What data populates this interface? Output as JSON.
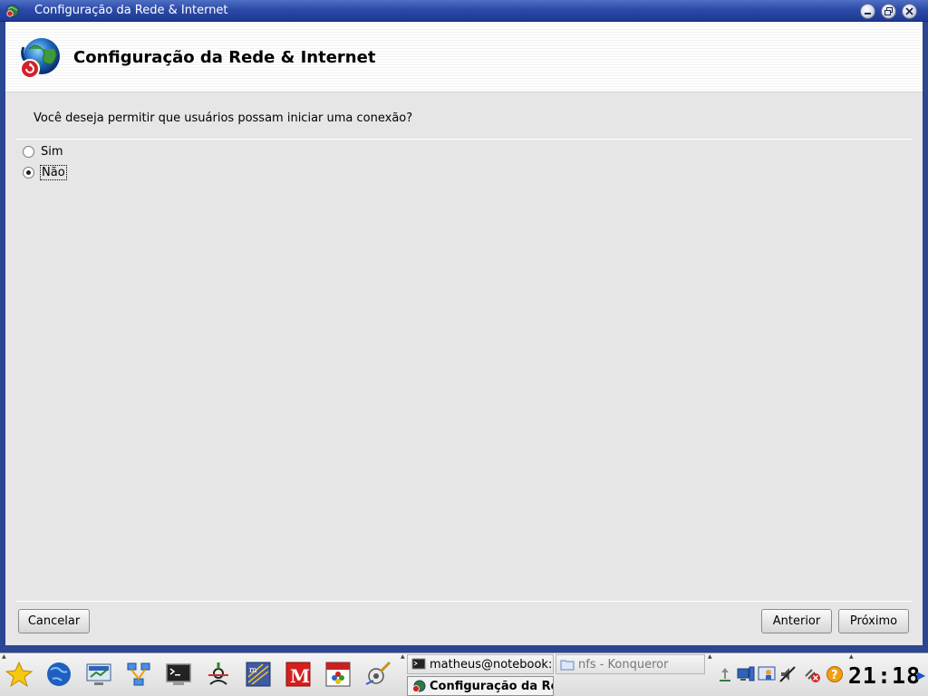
{
  "window": {
    "title": "Configuração da Rede & Internet"
  },
  "header": {
    "heading": "Configuração da Rede & Internet"
  },
  "main": {
    "question": "Você deseja permitir que usuários possam iniciar uma conexão?",
    "options": [
      {
        "label": "Sim",
        "selected": false
      },
      {
        "label": "Não",
        "selected": true
      }
    ]
  },
  "buttons": {
    "cancel": "Cancelar",
    "previous": "Anterior",
    "next": "Próximo"
  },
  "taskbar": {
    "launchers": [
      "kde-star-icon",
      "globe-icon",
      "network-monitor-icon",
      "network-share-icon",
      "terminal-icon",
      "package-tool-icon",
      "music-editor-icon",
      "mail-m-icon",
      "snes-emulator-icon",
      "system-config-icon"
    ],
    "tasks": [
      {
        "label": "matheus@notebook:",
        "icon": "terminal-icon",
        "active": false
      },
      {
        "label": "nfs - Konqueror",
        "icon": "folder-icon",
        "active": false
      },
      {
        "label": "Configuração da Re",
        "icon": "network-config-icon",
        "active": true
      }
    ],
    "tray": [
      "network-up-icon",
      "display-icon",
      "screen-config-icon",
      "volume-muted-icon",
      "network-disconnected-icon",
      "help-icon"
    ],
    "clock": "21:18"
  },
  "colors": {
    "titlebar": "#2c4aa8",
    "window_bg": "#e6e6e6",
    "frame": "#2b4693",
    "accent_red": "#d4202a"
  }
}
